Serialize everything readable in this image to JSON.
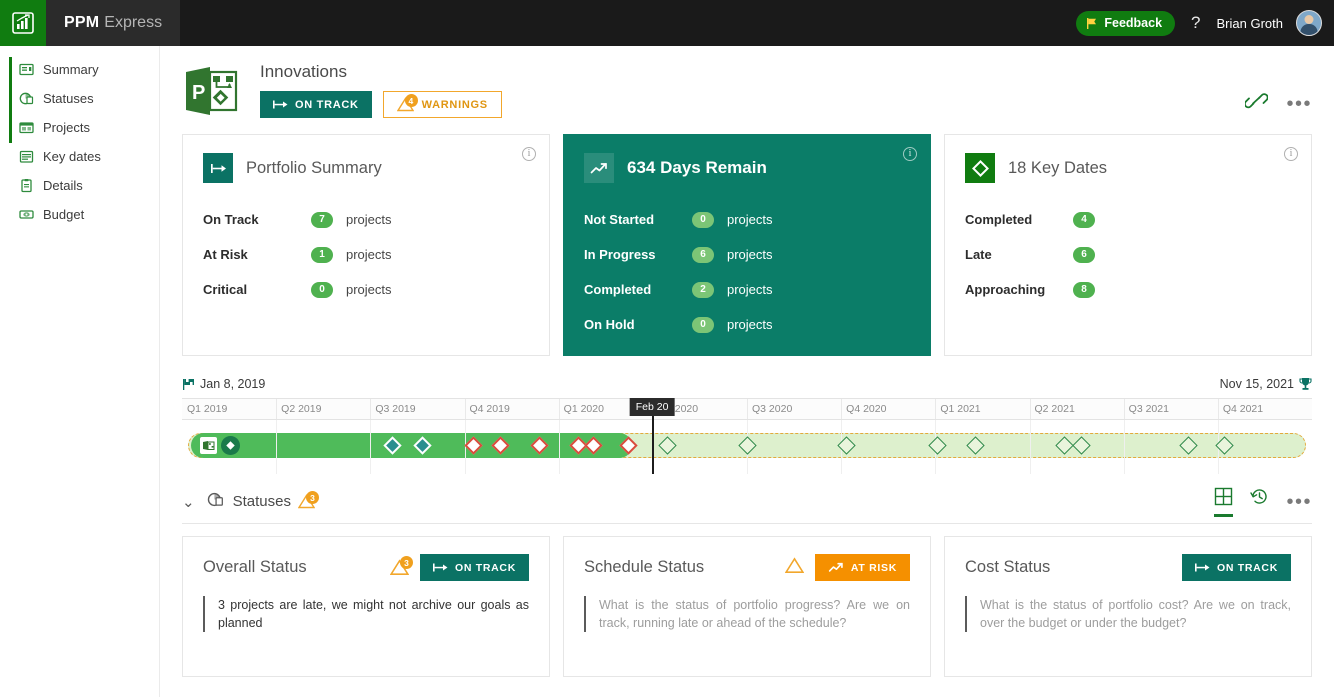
{
  "topbar": {
    "logo_icon": "chart-logo-icon",
    "brand_primary": "PPM",
    "brand_secondary": "Express",
    "feedback_label": "Feedback",
    "feedback_icon": "flag-icon",
    "help_label": "?",
    "user_name": "Brian Groth",
    "accent_green": "#107c10",
    "bar_color": "#1a1a1a"
  },
  "sidebar": {
    "items": [
      {
        "label": "Summary",
        "icon": "summary-icon"
      },
      {
        "label": "Statuses",
        "icon": "statuses-icon"
      },
      {
        "label": "Projects",
        "icon": "projects-icon"
      },
      {
        "label": "Key dates",
        "icon": "key-dates-icon"
      },
      {
        "label": "Details",
        "icon": "details-icon"
      },
      {
        "label": "Budget",
        "icon": "budget-icon"
      }
    ]
  },
  "project": {
    "logo_icon": "ms-project-icon",
    "title": "Innovations",
    "status_badge": {
      "label": "ON TRACK",
      "icon": "milestone-arrow-icon",
      "color": "#0b7264"
    },
    "warnings_badge": {
      "label": "WARNINGS",
      "count": "4",
      "icon": "warning-triangle-icon",
      "color": "#e09612"
    },
    "link_icon": "link-icon",
    "more_icon": "ellipsis-icon"
  },
  "kpi_cards": [
    {
      "title": "Portfolio Summary",
      "icon": "milestone-arrow-icon",
      "theme": "light",
      "info_icon": "info-icon",
      "rows": [
        {
          "label": "On Track",
          "value": "7",
          "unit": "projects"
        },
        {
          "label": "At Risk",
          "value": "1",
          "unit": "projects"
        },
        {
          "label": "Critical",
          "value": "0",
          "unit": "projects"
        }
      ]
    },
    {
      "title": "634 Days Remain",
      "icon": "trending-up-icon",
      "theme": "teal",
      "info_icon": "info-icon",
      "rows": [
        {
          "label": "Not Started",
          "value": "0",
          "unit": "projects"
        },
        {
          "label": "In Progress",
          "value": "6",
          "unit": "projects"
        },
        {
          "label": "Completed",
          "value": "2",
          "unit": "projects"
        },
        {
          "label": "On Hold",
          "value": "0",
          "unit": "projects"
        }
      ]
    },
    {
      "title": "18 Key Dates",
      "icon": "diamond-icon",
      "theme": "light",
      "info_icon": "info-icon",
      "rows": [
        {
          "label": "Completed",
          "value": "4",
          "unit": ""
        },
        {
          "label": "Late",
          "value": "6",
          "unit": ""
        },
        {
          "label": "Approaching",
          "value": "8",
          "unit": ""
        }
      ]
    }
  ],
  "timeline": {
    "start_date": "Jan 8, 2019",
    "end_date": "Nov 15, 2021",
    "start_icon": "flag-icon",
    "end_icon": "trophy-icon",
    "today_label": "Feb 20",
    "quarters": [
      "Q1 2019",
      "Q2 2019",
      "Q3 2019",
      "Q4 2019",
      "Q1 2020",
      "Q2 2020",
      "Q3 2020",
      "Q4 2020",
      "Q1 2021",
      "Q2 2021",
      "Q3 2021",
      "Q4 2021"
    ],
    "milestones": [
      {
        "pos": 18.6,
        "state": "done"
      },
      {
        "pos": 21.3,
        "state": "done"
      },
      {
        "pos": 25.8,
        "state": "late"
      },
      {
        "pos": 28.2,
        "state": "late"
      },
      {
        "pos": 31.6,
        "state": "late"
      },
      {
        "pos": 35.1,
        "state": "late"
      },
      {
        "pos": 36.4,
        "state": "late"
      },
      {
        "pos": 39.5,
        "state": "late"
      },
      {
        "pos": 43.0,
        "state": "future"
      },
      {
        "pos": 50.0,
        "state": "future"
      },
      {
        "pos": 58.8,
        "state": "future"
      },
      {
        "pos": 66.9,
        "state": "future"
      },
      {
        "pos": 70.2,
        "state": "future"
      },
      {
        "pos": 78.1,
        "state": "future"
      },
      {
        "pos": 79.6,
        "state": "future"
      },
      {
        "pos": 89.1,
        "state": "future"
      },
      {
        "pos": 92.3,
        "state": "future"
      }
    ]
  },
  "statuses_section": {
    "chevron_icon": "chevron-down-icon",
    "section_icon": "statuses-icon",
    "title": "Statuses",
    "warn_count": "3",
    "warn_icon": "warning-triangle-icon",
    "actions": [
      {
        "icon": "grid-view-icon",
        "active": true
      },
      {
        "icon": "history-clock-icon",
        "active": false
      },
      {
        "icon": "ellipsis-icon",
        "active": false
      }
    ]
  },
  "status_cards": [
    {
      "title": "Overall Status",
      "has_warning": true,
      "warn_count": "3",
      "warn_icon": "warning-triangle-icon",
      "chip": {
        "label": "ON TRACK",
        "icon": "milestone-arrow-icon",
        "style": "green"
      },
      "text": "3 projects are late, we might not archive our goals as planned",
      "placeholder": false
    },
    {
      "title": "Schedule Status",
      "has_warning": true,
      "warn_count": "",
      "warn_icon": "warning-triangle-icon",
      "chip": {
        "label": "AT RISK",
        "icon": "trending-up-icon",
        "style": "orange"
      },
      "text": "What is the status of portfolio progress? Are we on track, running late or ahead of the schedule?",
      "placeholder": true
    },
    {
      "title": "Cost Status",
      "has_warning": false,
      "warn_count": "",
      "warn_icon": "",
      "chip": {
        "label": "ON TRACK",
        "icon": "milestone-arrow-icon",
        "style": "green"
      },
      "text": "What is the status of portfolio cost? Are we on track, over the budget or under the budget?",
      "placeholder": true
    }
  ]
}
